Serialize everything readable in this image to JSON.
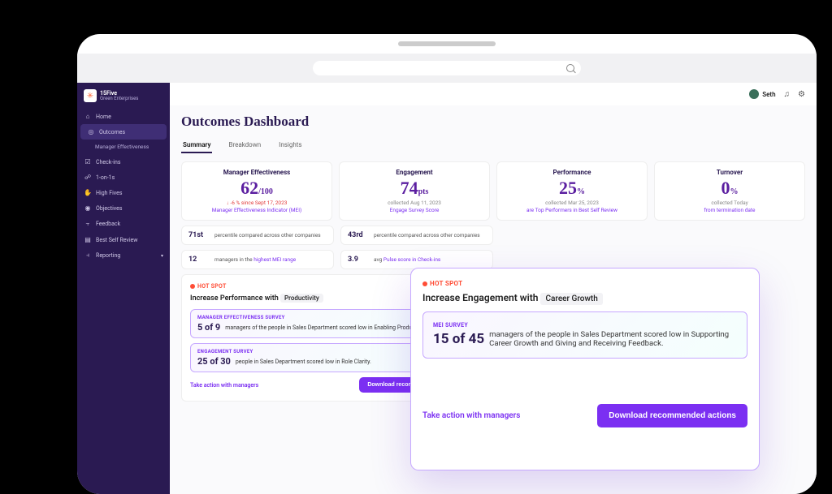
{
  "brand": {
    "name": "15Five",
    "org": "Green Enterprises"
  },
  "user": {
    "name": "Seth"
  },
  "nav": {
    "home": "Home",
    "outcomes": "Outcomes",
    "outcomes_sub": "Manager Effectiveness",
    "checkins": "Check-ins",
    "oneonones": "1-on-1s",
    "highfives": "High Fives",
    "objectives": "Objectives",
    "feedback": "Feedback",
    "bestself": "Best Self Review",
    "reporting": "Reporting"
  },
  "page_title": "Outcomes Dashboard",
  "tabs": {
    "summary": "Summary",
    "breakdown": "Breakdown",
    "insights": "Insights"
  },
  "cards": {
    "mei": {
      "title": "Manager Effectiveness",
      "value": "62",
      "unit": "/100",
      "delta": "↓ -6 % since Sept 17, 2023",
      "link": "Manager Effectiveness Indicator (MEI)"
    },
    "engagement": {
      "title": "Engagement",
      "value": "74",
      "unit": "pts",
      "sub": "collected Aug 11, 2023",
      "link": "Engage Survey Score"
    },
    "performance": {
      "title": "Performance",
      "value": "25",
      "unit": "%",
      "sub": "collected Mar 25, 2023",
      "link": "are Top Performers in Best Self Review"
    },
    "turnover": {
      "title": "Turnover",
      "value": "0",
      "unit": "%",
      "sub": "collected Today",
      "link": "from termination date"
    }
  },
  "minis": {
    "mei_percentile": {
      "stat": "71st",
      "text": "percentile compared across other companies"
    },
    "mei_managers": {
      "stat": "12",
      "text_prefix": "managers in the ",
      "text_link": "highest MEI range"
    },
    "eng_percentile": {
      "stat": "43rd",
      "text": "percentile compared across other companies"
    },
    "eng_pulse": {
      "stat": "3.9",
      "text_prefix": "avg ",
      "text_link": "Pulse score in Check-ins"
    }
  },
  "hotspot_perf": {
    "label": "HOT SPOT",
    "title_prefix": "Increase Performance  with ",
    "chip": "Productivity",
    "box1": {
      "tag": "MANAGER EFFECTIVENESS SURVEY",
      "ratio": "5 of 9",
      "text": "managers of the people in Sales Department scored low in Enabling Productivity."
    },
    "box2": {
      "tag": "ENGAGEMENT SURVEY",
      "ratio": "25 of 30",
      "text": "people in Sales Department  scored low in Role Clarity."
    },
    "link": "Take action with managers",
    "button": "Download recommended actions"
  },
  "hotspot_eng": {
    "label": "HOT SPOT",
    "title_prefix": "Increase Engagement  with ",
    "chip": "Career Growth",
    "box1": {
      "tag": "MEI SURVEY",
      "ratio": "15 of 45",
      "text": "managers of the people in Sales Department scored low in Supporting Career Growth and Giving and Receiving Feedback."
    },
    "link": "Take action with managers",
    "button": "Download recommended actions"
  }
}
